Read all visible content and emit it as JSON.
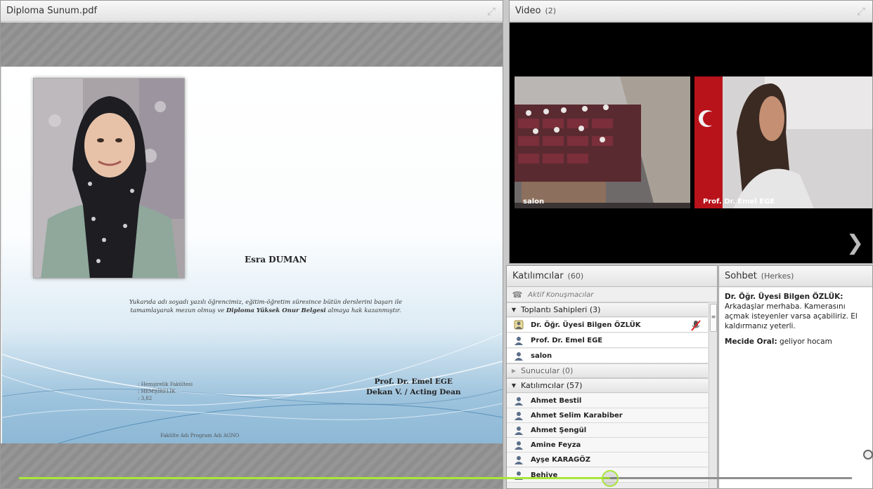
{
  "presentation": {
    "title": "Diploma Sunum.pdf",
    "slide": {
      "student_name": "Esra DUMAN",
      "description_pre": "Yukarıda adı soyadı yazılı öğrencimiz, eğitim-öğretim süresince bütün derslerini başarı ile tamamlayarak mezun olmuş ve",
      "description_bold": "Diploma Yüksek Onur Belgesi",
      "description_post": "almaya hak kazanmıştır.",
      "info_line1": ": Hemşirelik Fakültesi",
      "info_line2": ": HEMŞİRELİK",
      "info_line3": ": 3,82",
      "signer_name": "Prof. Dr. Emel EGE",
      "signer_title": "Dekan V. / Acting Dean",
      "footer": "Fakülte Adı  Program Adı  AGNO"
    }
  },
  "video": {
    "title": "Video",
    "count": "(2)",
    "tiles": [
      {
        "label": "salon"
      },
      {
        "label": "Prof. Dr. Emel EGE"
      }
    ]
  },
  "attendees": {
    "title": "Katılımcılar",
    "count": "(60)",
    "active_speakers": "Aktif Konuşmacılar",
    "hosts_header": "Toplantı Sahipleri (3)",
    "hosts": [
      "Dr. Öğr. Üyesi Bilgen ÖZLÜK",
      "Prof. Dr. Emel EGE",
      "salon"
    ],
    "presenters_header": "Sunucular (0)",
    "participants_header": "Katılımcılar (57)",
    "participants": [
      "Ahmet Bestil",
      "Ahmet Selim Karabiber",
      "Ahmet Şengül",
      "Amine Feyza",
      "Ayşe KARAGÖZ",
      "Behiye"
    ]
  },
  "chat": {
    "title": "Sohbet",
    "scope": "(Herkes)",
    "messages": [
      {
        "author": "Dr. Öğr. Üyesi Bilgen ÖZLÜK:",
        "text": "Arkadaşlar merhaba. Kamerasını açmak isteyenler varsa açabiliriz. El kaldırmanız yeterli."
      },
      {
        "author": "Mecide Oral:",
        "text": "geliyor hocam"
      }
    ]
  },
  "playback": {
    "progress_fraction": 0.71
  },
  "icons": {
    "expand": "expand-icon",
    "phone": "phone-icon",
    "person": "person-icon",
    "next": "chevron-right-icon",
    "mic_off": "microphone-muted-icon"
  },
  "colors": {
    "progress": "#a8e63c",
    "video_bg": "#000000"
  }
}
